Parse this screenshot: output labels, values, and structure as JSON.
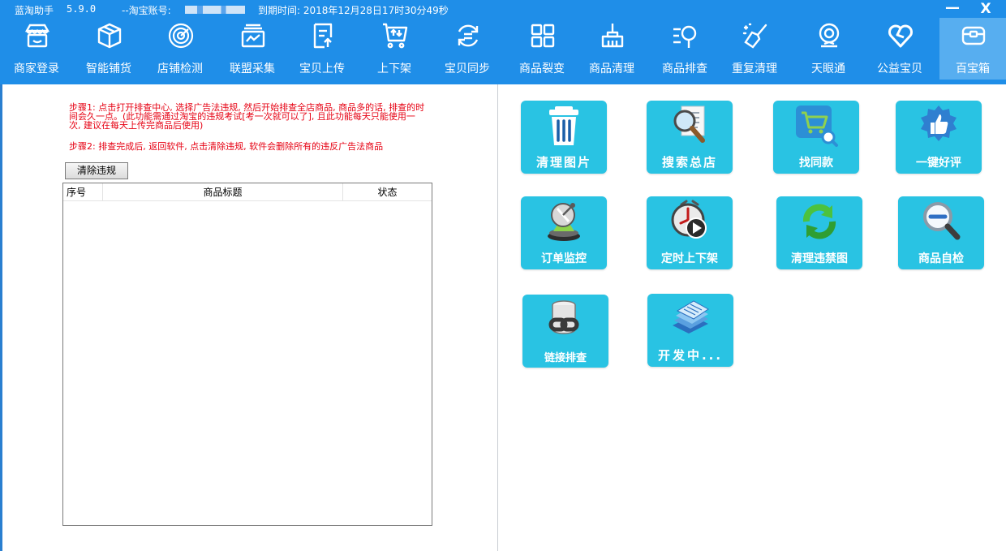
{
  "window": {
    "app_name": "蓝淘助手",
    "version": "5.9.0",
    "account_label": "--淘宝账号:",
    "expire_text": "到期时间: 2018年12月28日17时30分49秒",
    "minimize_label": "—",
    "close_label": "X"
  },
  "nav": {
    "items": [
      {
        "label": "商家登录",
        "icon": "store-icon"
      },
      {
        "label": "智能铺货",
        "icon": "box-icon"
      },
      {
        "label": "店铺检测",
        "icon": "radar-icon"
      },
      {
        "label": "联盟采集",
        "icon": "collect-icon"
      },
      {
        "label": "宝贝上传",
        "icon": "upload-doc-icon"
      },
      {
        "label": "上下架",
        "icon": "cart-icon"
      },
      {
        "label": "宝贝同步",
        "icon": "sync-icon"
      },
      {
        "label": "商品裂变",
        "icon": "grid-icon"
      },
      {
        "label": "商品清理",
        "icon": "broom-icon"
      },
      {
        "label": "商品排查",
        "icon": "search-list-icon"
      },
      {
        "label": "重复清理",
        "icon": "sweep-icon"
      },
      {
        "label": "天眼通",
        "icon": "eye-icon"
      },
      {
        "label": "公益宝贝",
        "icon": "heart-icon"
      },
      {
        "label": "百宝箱",
        "icon": "toolbox-icon"
      }
    ],
    "active_index": 13
  },
  "left": {
    "step1": "步骤1: 点击打开排查中心, 选择广告法违规, 然后开始排查全店商品, 商品多的话, 排查的时间会久一点。(此功能需通过淘宝的违规考试[考一次就可以了], 且此功能每天只能使用一次, 建议在每天上传完商品后使用)",
    "step2": "步骤2: 排查完成后, 返回软件, 点击清除违规, 软件会删除所有的违反广告法商品",
    "clear_button": "清除违规",
    "table": {
      "columns": [
        "序号",
        "商品标题",
        "状态"
      ],
      "rows": []
    }
  },
  "tools": [
    {
      "label": "清理图片",
      "icon": "trash-icon"
    },
    {
      "label": "搜索总店",
      "icon": "magnifier-doc-icon"
    },
    {
      "label": "找同款",
      "icon": "cart-search-icon"
    },
    {
      "label": "一键好评",
      "icon": "thumbs-up-icon"
    },
    {
      "label": "订单监控",
      "icon": "satellite-icon"
    },
    {
      "label": "定时上下架",
      "icon": "clock-play-icon"
    },
    {
      "label": "清理违禁图",
      "icon": "recycle-icon"
    },
    {
      "label": "商品自检",
      "icon": "zoom-out-icon"
    },
    {
      "label": "链接排查",
      "icon": "link-db-icon"
    },
    {
      "label": "开发中...",
      "icon": "stack-icon"
    }
  ]
}
